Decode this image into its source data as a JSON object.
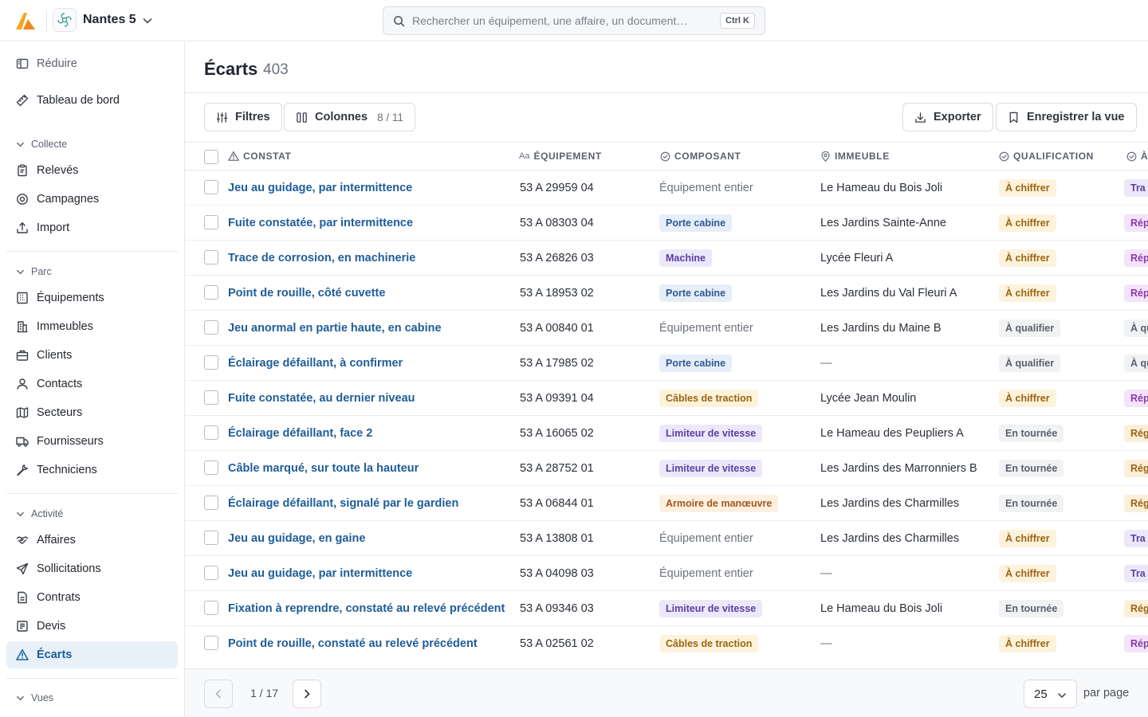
{
  "topbar": {
    "org_name": "Nantes 5",
    "search_placeholder": "Rechercher un équipement, une affaire, un document…",
    "search_shortcut": "Ctrl K"
  },
  "sidebar": {
    "collapse_label": "Réduire",
    "dashboard_label": "Tableau de bord",
    "sections": [
      {
        "title": "Collecte",
        "items": [
          {
            "label": "Relevés",
            "icon": "clipboard-icon"
          },
          {
            "label": "Campagnes",
            "icon": "target-icon"
          },
          {
            "label": "Import",
            "icon": "upload-icon"
          }
        ]
      },
      {
        "title": "Parc",
        "items": [
          {
            "label": "Équipements",
            "icon": "building-grid-icon"
          },
          {
            "label": "Immeubles",
            "icon": "buildings-icon"
          },
          {
            "label": "Clients",
            "icon": "briefcase-icon"
          },
          {
            "label": "Contacts",
            "icon": "user-icon"
          },
          {
            "label": "Secteurs",
            "icon": "map-icon"
          },
          {
            "label": "Fournisseurs",
            "icon": "truck-icon"
          },
          {
            "label": "Techniciens",
            "icon": "wrench-icon"
          }
        ]
      },
      {
        "title": "Activité",
        "items": [
          {
            "label": "Affaires",
            "icon": "handshake-icon"
          },
          {
            "label": "Sollicitations",
            "icon": "send-icon"
          },
          {
            "label": "Contrats",
            "icon": "file-icon"
          },
          {
            "label": "Devis",
            "icon": "receipt-icon"
          },
          {
            "label": "Écarts",
            "icon": "warning-icon",
            "active": true
          }
        ]
      },
      {
        "title": "Vues",
        "items": []
      }
    ]
  },
  "page": {
    "title": "Écarts",
    "count": "403"
  },
  "toolbar": {
    "filters_label": "Filtres",
    "columns_label": "Colonnes",
    "columns_count": "8 / 11",
    "export_label": "Exporter",
    "save_view_label": "Enregistrer la vue"
  },
  "table": {
    "columns": [
      "CONSTAT",
      "ÉQUIPEMENT",
      "COMPOSANT",
      "IMMEUBLE",
      "QUALIFICATION",
      "À"
    ],
    "rows": [
      {
        "constat": "Jeu au guidage, par intermittence",
        "equipement": "53 A 29959 04",
        "composant": "Équipement entier",
        "composant_tag": "",
        "immeuble": "Le Hameau du Bois Joli",
        "qualification": "À chiffrer",
        "qual_tag": "yellow",
        "next": "Tra",
        "next_tag": "violet"
      },
      {
        "constat": "Fuite constatée, par intermittence",
        "equipement": "53 A 08303 04",
        "composant": "Porte cabine",
        "composant_tag": "blue",
        "immeuble": "Les Jardins Sainte-Anne",
        "qualification": "À chiffrer",
        "qual_tag": "yellow",
        "next": "Rép",
        "next_tag": "purple"
      },
      {
        "constat": "Trace de corrosion, en machinerie",
        "equipement": "53 A 26826 03",
        "composant": "Machine",
        "composant_tag": "violet",
        "immeuble": "Lycée Fleuri A",
        "qualification": "À chiffrer",
        "qual_tag": "yellow",
        "next": "Rép",
        "next_tag": "purple"
      },
      {
        "constat": "Point de rouille, côté cuvette",
        "equipement": "53 A 18953 02",
        "composant": "Porte cabine",
        "composant_tag": "blue",
        "immeuble": "Les Jardins du Val Fleuri A",
        "qualification": "À chiffrer",
        "qual_tag": "yellow",
        "next": "Rép",
        "next_tag": "purple"
      },
      {
        "constat": "Jeu anormal en partie haute, en cabine",
        "equipement": "53 A 00840 01",
        "composant": "Équipement entier",
        "composant_tag": "",
        "immeuble": "Les Jardins du Maine B",
        "qualification": "À qualifier",
        "qual_tag": "gray",
        "next": "À qu",
        "next_tag": "gray"
      },
      {
        "constat": "Éclairage défaillant, à confirmer",
        "equipement": "53 A 17985 02",
        "composant": "Porte cabine",
        "composant_tag": "blue",
        "immeuble": "—",
        "qualification": "À qualifier",
        "qual_tag": "gray",
        "next": "À qu",
        "next_tag": "gray"
      },
      {
        "constat": "Fuite constatée, au dernier niveau",
        "equipement": "53 A 09391 04",
        "composant": "Câbles de traction",
        "composant_tag": "yellow",
        "immeuble": "Lycée Jean Moulin",
        "qualification": "À chiffrer",
        "qual_tag": "yellow",
        "next": "Rép",
        "next_tag": "purple"
      },
      {
        "constat": "Éclairage défaillant, face 2",
        "equipement": "53 A 16065 02",
        "composant": "Limiteur de vitesse",
        "composant_tag": "violet",
        "immeuble": "Le Hameau des Peupliers A",
        "qualification": "En tournée",
        "qual_tag": "gray",
        "next": "Rég",
        "next_tag": "amber"
      },
      {
        "constat": "Câble marqué, sur toute la hauteur",
        "equipement": "53 A 28752 01",
        "composant": "Limiteur de vitesse",
        "composant_tag": "violet",
        "immeuble": "Les Jardins des Marronniers B",
        "qualification": "En tournée",
        "qual_tag": "gray",
        "next": "Rég",
        "next_tag": "amber"
      },
      {
        "constat": "Éclairage défaillant, signalé par le gardien",
        "equipement": "53 A 06844 01",
        "composant": "Armoire de manœuvre",
        "composant_tag": "orange",
        "immeuble": "Les Jardins des Charmilles",
        "qualification": "En tournée",
        "qual_tag": "gray",
        "next": "Rég",
        "next_tag": "amber"
      },
      {
        "constat": "Jeu au guidage, en gaine",
        "equipement": "53 A 13808 01",
        "composant": "Équipement entier",
        "composant_tag": "",
        "immeuble": "Les Jardins des Charmilles",
        "qualification": "À chiffrer",
        "qual_tag": "yellow",
        "next": "Tra",
        "next_tag": "violet"
      },
      {
        "constat": "Jeu au guidage, par intermittence",
        "equipement": "53 A 04098 03",
        "composant": "Équipement entier",
        "composant_tag": "",
        "immeuble": "—",
        "qualification": "À chiffrer",
        "qual_tag": "yellow",
        "next": "Tra",
        "next_tag": "violet"
      },
      {
        "constat": "Fixation à reprendre, constaté au relevé précédent",
        "equipement": "53 A 09346 03",
        "composant": "Limiteur de vitesse",
        "composant_tag": "violet",
        "immeuble": "Le Hameau du Bois Joli",
        "qualification": "En tournée",
        "qual_tag": "gray",
        "next": "Rég",
        "next_tag": "amber"
      },
      {
        "constat": "Point de rouille, constaté au relevé précédent",
        "equipement": "53 A 02561 02",
        "composant": "Câbles de traction",
        "composant_tag": "yellow",
        "immeuble": "—",
        "qualification": "À chiffrer",
        "qual_tag": "yellow",
        "next": "Rép",
        "next_tag": "purple"
      }
    ]
  },
  "pagination": {
    "page_text": "1 / 17",
    "per_page_value": "25",
    "per_page_label": "par page"
  },
  "colors": {
    "accent": "#1f5d99",
    "logo_orange": "#f5a623",
    "active_bg": "#e8f0f8"
  }
}
